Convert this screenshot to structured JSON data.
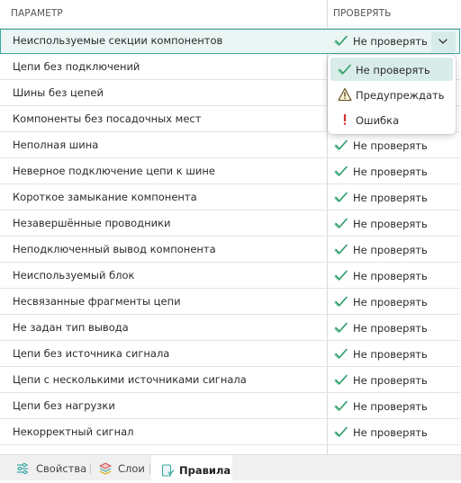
{
  "header": {
    "param": "ПАРАМЕТР",
    "check": "ПРОВЕРЯТЬ"
  },
  "rows": [
    {
      "param": "Неиспользуемые секции компонентов",
      "value": "Не проверять"
    },
    {
      "param": "Цепи без подключений",
      "value": ""
    },
    {
      "param": "Шины без цепей",
      "value": ""
    },
    {
      "param": "Компоненты без посадочных мест",
      "value": ""
    },
    {
      "param": "Неполная шина",
      "value": "Не проверять"
    },
    {
      "param": "Неверное подключение цепи к шине",
      "value": "Не проверять"
    },
    {
      "param": "Короткое замыкание компонента",
      "value": "Не проверять"
    },
    {
      "param": "Незавершённые проводники",
      "value": "Не проверять"
    },
    {
      "param": "Неподключенный вывод компонента",
      "value": "Не проверять"
    },
    {
      "param": "Неиспользуемый блок",
      "value": "Не проверять"
    },
    {
      "param": "Несвязанные фрагменты цепи",
      "value": "Не проверять"
    },
    {
      "param": "Не задан тип вывода",
      "value": "Не проверять"
    },
    {
      "param": "Цепи без источника сигнала",
      "value": "Не проверять"
    },
    {
      "param": "Цепи с несколькими источниками сигнала",
      "value": "Не проверять"
    },
    {
      "param": "Цепи без нагрузки",
      "value": "Не проверять"
    },
    {
      "param": "Некорректный сигнал",
      "value": "Не проверять"
    }
  ],
  "dropdown": {
    "options": [
      {
        "label": "Не проверять",
        "icon": "check-icon"
      },
      {
        "label": "Предупреждать",
        "icon": "warning-icon"
      },
      {
        "label": "Ошибка",
        "icon": "error-icon"
      }
    ],
    "selected": "Не проверять"
  },
  "tabs": [
    {
      "label": "Свойства",
      "icon": "properties-icon",
      "active": false
    },
    {
      "label": "Слои",
      "icon": "layers-icon",
      "active": false
    },
    {
      "label": "Правила",
      "icon": "rules-icon",
      "active": true
    }
  ],
  "colors": {
    "accent": "#3aa7a1",
    "check": "#2e9e6a",
    "warning": "#e0a000",
    "error": "#d32f2f"
  }
}
